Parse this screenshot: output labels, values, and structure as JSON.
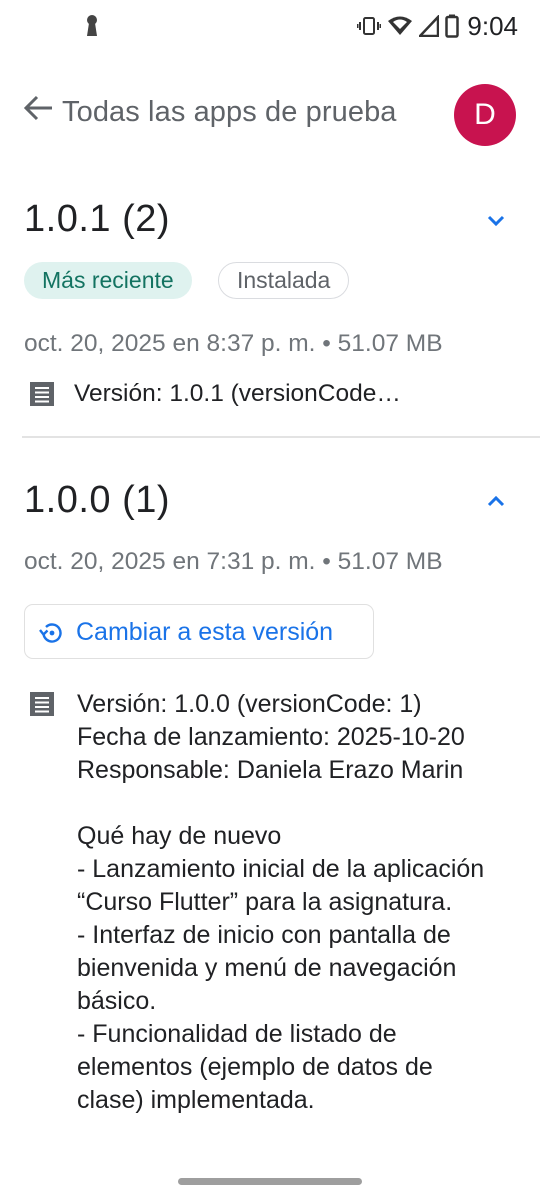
{
  "status_bar": {
    "time": "9:04"
  },
  "header": {
    "title": "Todas las apps de prueba",
    "avatar_initial": "D"
  },
  "releases": [
    {
      "title": "1.0.1 (2)",
      "chips": {
        "latest": "Más reciente",
        "installed": "Instalada"
      },
      "meta": "oct. 20, 2025 en 8:37 p. m. • 51.07 MB",
      "version_summary": "Versión: 1.0.1 (versionCode…"
    },
    {
      "title": "1.0.0 (1)",
      "meta": "oct. 20, 2025 en 7:31 p. m. • 51.07 MB",
      "switch_button_label": "Cambiar a esta versión",
      "details": {
        "version": "Versión: 1.0.0 (versionCode: 1)",
        "release_date": "Fecha de lanzamiento: 2025-10-20",
        "owner": "Responsable: Daniela Erazo Marin",
        "whats_new_title": "Qué hay de nuevo",
        "whats_new_lines": [
          "- Lanzamiento inicial de la aplicación",
          "“Curso Flutter” para la asignatura.",
          "- Interfaz de inicio con pantalla de",
          "bienvenida y menú de navegación",
          "básico.",
          "- Funcionalidad de listado de",
          "elementos (ejemplo de datos de",
          "clase) implementada."
        ]
      }
    }
  ],
  "colors": {
    "avatar": "#c8134f",
    "accent": "#1a73e8",
    "chip_latest_bg": "#dff2ef",
    "chip_latest_text": "#137361"
  }
}
